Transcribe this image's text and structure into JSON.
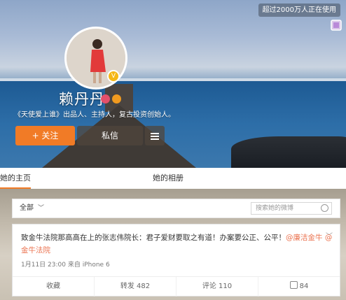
{
  "header": {
    "badge_text": "超过2000万人正在使用"
  },
  "profile": {
    "name": "赖丹丹",
    "bio": "《天使爱上谁》出品人、主持人，复古投资创始人。",
    "follow_label": "+ 关注",
    "message_label": "私信"
  },
  "tabs": {
    "home": "她的主页",
    "album": "她的相册"
  },
  "feed": {
    "filter_label": "全部",
    "search_placeholder": "搜索她的微博",
    "post": {
      "text_main": "致金牛法院那高高在上的张志伟院长：君子爱财要取之有道！办案要公正、公平！",
      "mention_1": "@廉洁金牛",
      "mention_2": "@金牛法院",
      "meta": "1月11日 23:00 来自 iPhone 6",
      "actions": {
        "favorite": "收藏",
        "repost": "转发 482",
        "comment": "评论 110",
        "like": "84"
      }
    }
  },
  "colors": {
    "accent": "#f17b26",
    "link": "#eb7350"
  }
}
